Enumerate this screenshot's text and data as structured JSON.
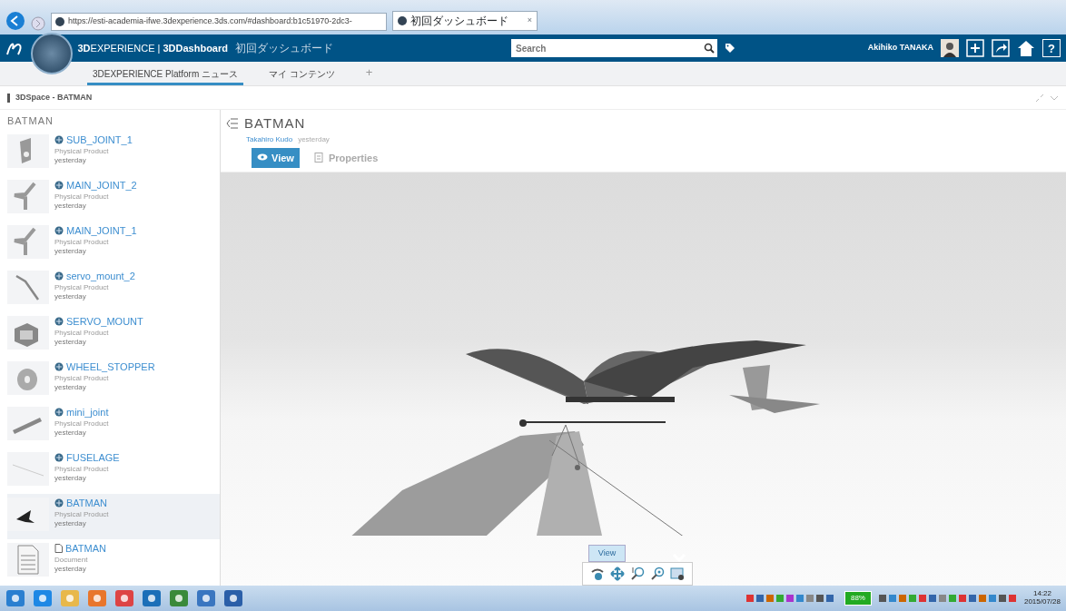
{
  "browser": {
    "url": "https://esti-academia-ifwe.3dexperience.3ds.com/#dashboard:b1c51970-2dc3-",
    "tab_title": "初回ダッシュボード",
    "tab_close": "×"
  },
  "header": {
    "brand": "**3D**EXPERIENCE | **3DDashboard**",
    "dashboard_name": "初回ダッシュボード",
    "search_placeholder": "Search",
    "user": "Akihiko TANAKA",
    "help": "?"
  },
  "tabs": [
    {
      "label": "3DEXPERIENCE Platform ニュース",
      "selected": true
    },
    {
      "label": "マイ コンテンツ",
      "selected": false
    }
  ],
  "add_tab": "+",
  "breadcrumb": "3DSpace - BATMAN",
  "list": {
    "title": "BATMAN",
    "items": [
      {
        "kind": "product",
        "name": "SUB_JOINT_1",
        "type": "Physical Product",
        "date": "yesterday",
        "selected": false
      },
      {
        "kind": "product",
        "name": "MAIN_JOINT_2",
        "type": "Physical Product",
        "date": "yesterday",
        "selected": false
      },
      {
        "kind": "product",
        "name": "MAIN_JOINT_1",
        "type": "Physical Product",
        "date": "yesterday",
        "selected": false
      },
      {
        "kind": "product",
        "name": "servo_mount_2",
        "type": "Physical Product",
        "date": "yesterday",
        "selected": false
      },
      {
        "kind": "product",
        "name": "SERVO_MOUNT",
        "type": "Physical Product",
        "date": "yesterday",
        "selected": false
      },
      {
        "kind": "product",
        "name": "WHEEL_STOPPER",
        "type": "Physical Product",
        "date": "yesterday",
        "selected": false
      },
      {
        "kind": "product",
        "name": "mini_joint",
        "type": "Physical Product",
        "date": "yesterday",
        "selected": false
      },
      {
        "kind": "product",
        "name": "FUSELAGE",
        "type": "Physical Product",
        "date": "yesterday",
        "selected": false
      },
      {
        "kind": "product",
        "name": "BATMAN",
        "type": "Physical Product",
        "date": "yesterday",
        "selected": true
      },
      {
        "kind": "document",
        "name": "BATMAN",
        "type": "Document",
        "date": "yesterday",
        "selected": false
      }
    ]
  },
  "detail": {
    "title": "BATMAN",
    "author": "Takahiro Kudo",
    "date": "yesterday",
    "tabs": [
      {
        "label": "View",
        "selected": true
      },
      {
        "label": "Properties",
        "selected": false
      }
    ]
  },
  "viewer": {
    "toolbar_tab": "View"
  },
  "taskbar": {
    "battery": "88%",
    "time": "14:22",
    "date": "2015/07/28"
  }
}
